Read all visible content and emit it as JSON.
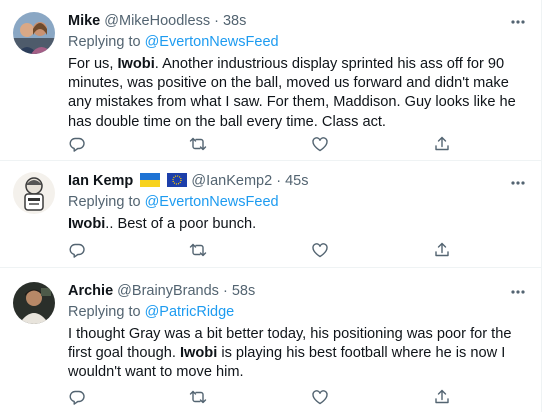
{
  "tweets": [
    {
      "name": "Mike",
      "handle": "@MikeHoodless",
      "time": "38s",
      "replying_prefix": "Replying to ",
      "replying_to": "@EvertonNewsFeed",
      "body": [
        {
          "t": "For us, "
        },
        {
          "t": "Iwobi",
          "b": true
        },
        {
          "t": ". Another industrious display sprinted his ass off for 90 minutes, was positive on the ball, moved us forward and didn't make any mistakes from what I saw. For them, Maddison. Guy looks like he has double time on the ball every time. Class act."
        }
      ]
    },
    {
      "name": "Ian Kemp",
      "handle": "@IanKemp2",
      "time": "45s",
      "replying_prefix": "Replying to ",
      "replying_to": "@EvertonNewsFeed",
      "body": [
        {
          "t": "Iwobi",
          "b": true
        },
        {
          "t": ".. Best of a poor bunch."
        }
      ]
    },
    {
      "name": "Archie",
      "handle": "@BrainyBrands",
      "time": "58s",
      "replying_prefix": "Replying to ",
      "replying_to": "@PatricRidge",
      "body": [
        {
          "t": "I thought Gray was a bit better today, his positioning was poor for the first goal though. "
        },
        {
          "t": "Iwobi",
          "b": true
        },
        {
          "t": " is playing his best football where he is now I wouldn't want to move him."
        }
      ]
    }
  ],
  "separator": " · ",
  "icons": [
    "reply-icon",
    "retweet-icon",
    "like-icon",
    "share-icon",
    "more-icon"
  ],
  "colors": {
    "link": "#1d9bf0",
    "secondary": "#536471",
    "text": "#0f1419"
  }
}
